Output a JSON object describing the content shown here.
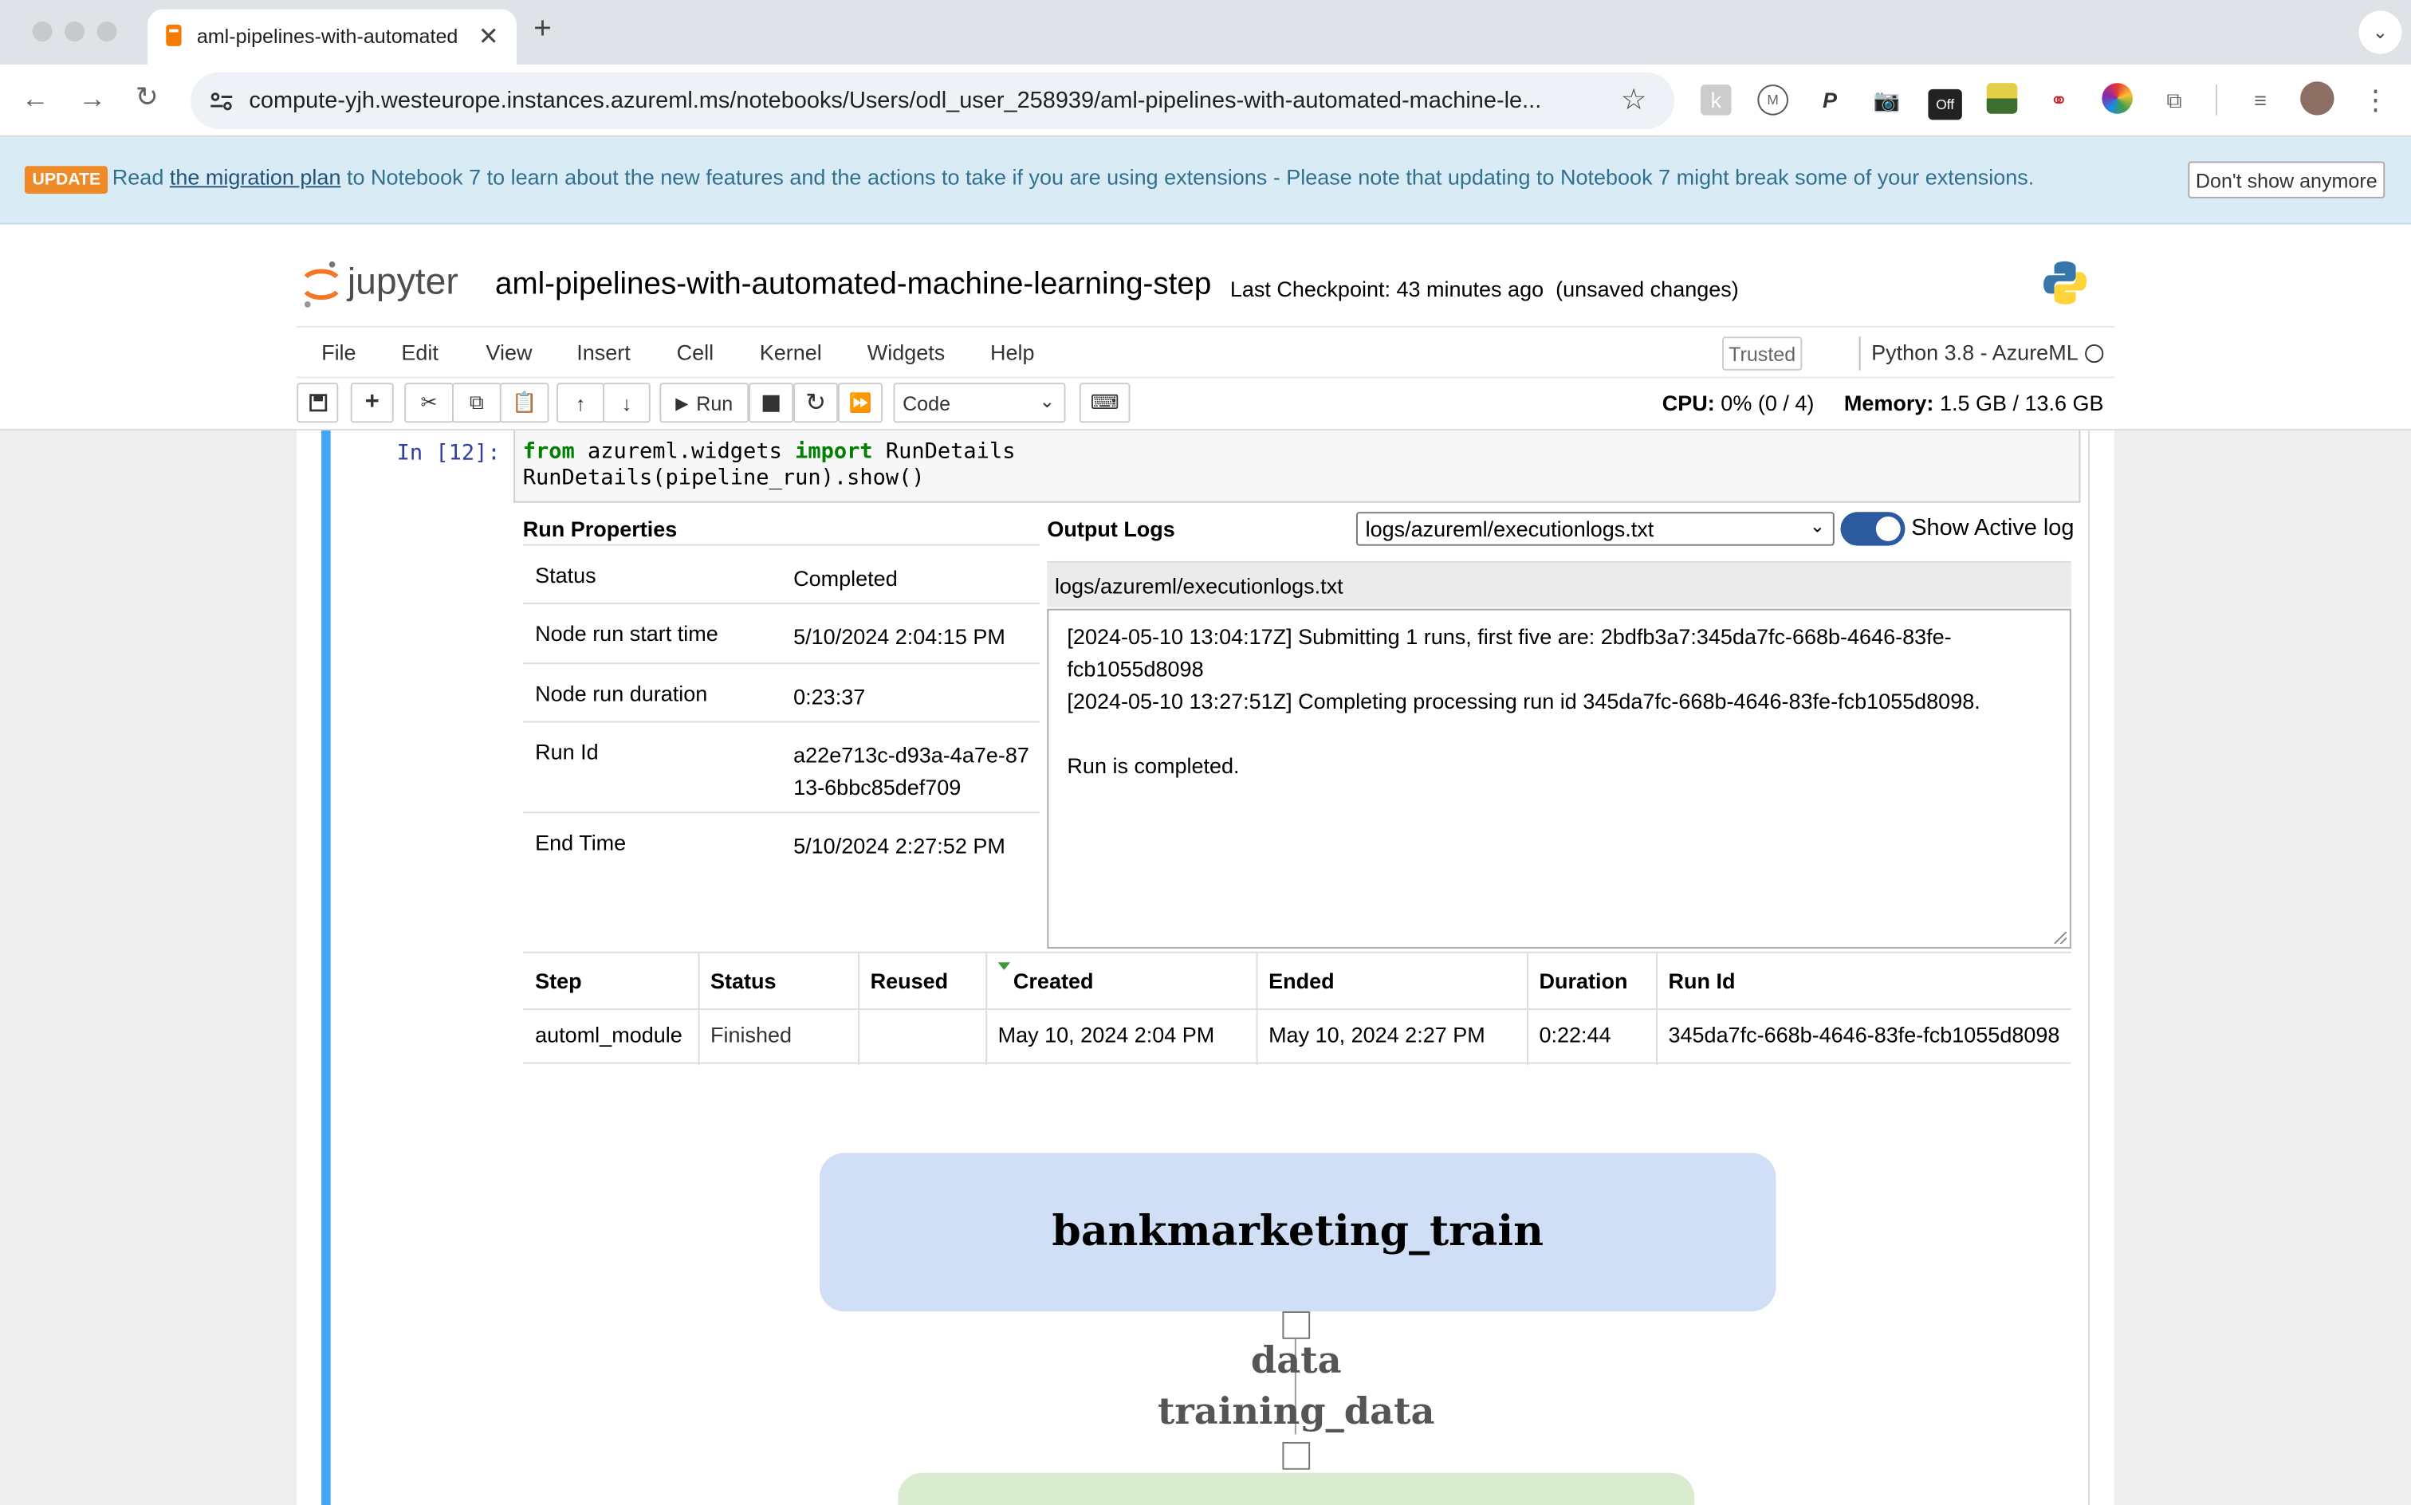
{
  "browser": {
    "tab_title": "aml-pipelines-with-automated-machine-learning-step",
    "url": "compute-yjh.westeurope.instances.azureml.ms/notebooks/Users/odl_user_258939/aml-pipelines-with-automated-machine-le..."
  },
  "update_banner": {
    "badge": "UPDATE",
    "text_before": "Read ",
    "link": "the migration plan",
    "text_after": " to Notebook 7 to learn about the new features and the actions to take if you are using extensions - Please note that updating to Notebook 7 might break some of your extensions.",
    "dismiss": "Don't show anymore"
  },
  "jupyter": {
    "logo_text": "jupyter",
    "notebook_title": "aml-pipelines-with-automated-machine-learning-step",
    "checkpoint": "Last Checkpoint: 43 minutes ago",
    "unsaved": "(unsaved changes)",
    "menus": [
      "File",
      "Edit",
      "View",
      "Insert",
      "Cell",
      "Kernel",
      "Widgets",
      "Help"
    ],
    "trusted": "Trusted",
    "kernel": "Python 3.8 - AzureML",
    "toolbar": {
      "run": "Run",
      "cell_type": "Code"
    },
    "cpu_label": "CPU:",
    "cpu_value": "0% (0 / 4)",
    "mem_label": "Memory:",
    "mem_value": "1.5 GB / 13.6 GB"
  },
  "cell": {
    "prompt": "In [12]:",
    "code_line1_kw1": "from",
    "code_line1_mid": " azureml.widgets ",
    "code_line1_kw2": "import",
    "code_line1_end": " RunDetails",
    "code_line2": "RunDetails(pipeline_run).show()"
  },
  "run_properties": {
    "title": "Run Properties",
    "rows": [
      {
        "key": "Status",
        "value": "Completed"
      },
      {
        "key": "Node run start time",
        "value": "5/10/2024 2:04:15 PM"
      },
      {
        "key": "Node run duration",
        "value": "0:23:37"
      },
      {
        "key": "Run Id",
        "value": "a22e713c-d93a-4a7e-8713-6bbc85def709"
      },
      {
        "key": "End Time",
        "value": "5/10/2024 2:27:52 PM"
      }
    ]
  },
  "output_logs": {
    "title": "Output Logs",
    "selected_log": "logs/azureml/executionlogs.txt",
    "toggle_label": "Show Active log",
    "toggle_on": true,
    "header": "logs/azureml/executionlogs.txt",
    "lines": [
      "[2024-05-10 13:04:17Z] Submitting 1 runs, first five are: 2bdfb3a7:345da7fc-668b-4646-83fe-fcb1055d8098",
      "[2024-05-10 13:27:51Z] Completing processing run id 345da7fc-668b-4646-83fe-fcb1055d8098.",
      "",
      "Run is completed."
    ]
  },
  "steps_table": {
    "headers": [
      "Step",
      "Status",
      "Reused",
      "Created",
      "Ended",
      "Duration",
      "Run Id"
    ],
    "row": [
      "automl_module",
      "Finished",
      "",
      "May 10, 2024 2:04 PM",
      "May 10, 2024 2:27 PM",
      "0:22:44",
      "345da7fc-668b-4646-83fe-fcb1055d8098"
    ]
  },
  "graph": {
    "node1": "bankmarketing_train",
    "edge_label1": "data",
    "edge_label2": "training_data"
  },
  "colors": {
    "accent": "#42a5f5",
    "update_badge": "#ef8a29",
    "node1": "#d0dff6",
    "node2": "#d9ecd0"
  }
}
